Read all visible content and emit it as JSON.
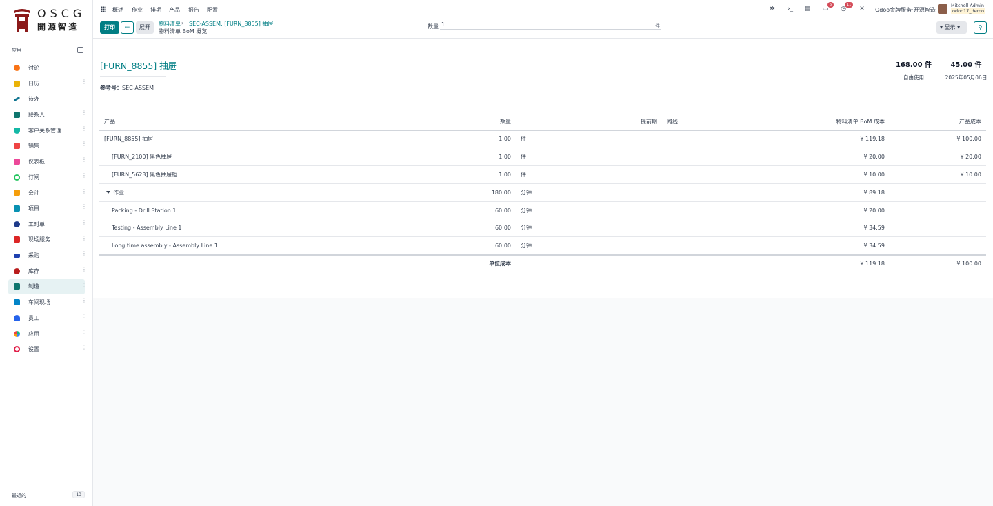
{
  "brand": {
    "name": "OSCG",
    "subtitle": "開源智造",
    "logo_color": "#8b1a1a"
  },
  "sidebar": {
    "apps_label": "应用",
    "items": [
      {
        "label": "讨论",
        "color": "#f97316"
      },
      {
        "label": "日历",
        "color": "#eab308"
      },
      {
        "label": "待办",
        "color": "#0e7490"
      },
      {
        "label": "联系人",
        "color": "#0f766e"
      },
      {
        "label": "客户关系管理",
        "color": "#14b8a6"
      },
      {
        "label": "销售",
        "color": "#ef4444"
      },
      {
        "label": "仪表板",
        "color": "#ec4899"
      },
      {
        "label": "订阅",
        "color": "#22c55e"
      },
      {
        "label": "会计",
        "color": "#f59e0b"
      },
      {
        "label": "项目",
        "color": "#0891b2"
      },
      {
        "label": "工时单",
        "color": "#1e3a8a"
      },
      {
        "label": "现场服务",
        "color": "#dc2626"
      },
      {
        "label": "采购",
        "color": "#1e40af"
      },
      {
        "label": "库存",
        "color": "#b91c1c"
      },
      {
        "label": "制造",
        "color": "#0f766e"
      },
      {
        "label": "车间现场",
        "color": "#0284c7"
      },
      {
        "label": "员工",
        "color": "#2563eb"
      },
      {
        "label": "应用",
        "color": "#10b981"
      },
      {
        "label": "设置",
        "color": "#e11d48"
      }
    ],
    "recent_label": "最近的",
    "recent_count": "13"
  },
  "topnav": {
    "items": [
      "概述",
      "作业",
      "排期",
      "产品",
      "报告",
      "配置"
    ],
    "badge_messages": "6",
    "badge_activities": "11",
    "company": "Odoo金牌服务·开源智造",
    "user_name": "Mitchell Admin",
    "user_db": "odoo17_demo"
  },
  "control": {
    "print_label": "打印",
    "back_icon": "arrow-left-icon",
    "expand_label": "展开",
    "breadcrumb_parent": "物料清单",
    "breadcrumb_current": "SEC-ASSEM: [FURN_8855] 抽屉",
    "subtitle": "物料清单 BoM 概览",
    "quantity_label": "数量",
    "quantity_value": "1",
    "quantity_uom": "件",
    "show_label": "显示"
  },
  "report": {
    "title": "[FURN_8855] 抽屉",
    "ref_label": "参考号：",
    "ref_value": "SEC-ASSEM",
    "kpi_free": {
      "value": "168.00 件",
      "label": "自由使用"
    },
    "kpi_forecast": {
      "value": "45.00 件",
      "label": "2025年05月06日"
    },
    "columns": [
      "产品",
      "数量",
      "",
      "提前期",
      "路线",
      "物料清单 BoM 成本",
      "产品成本"
    ],
    "rows": [
      {
        "product": "[FURN_8855] 抽屉",
        "qty": "1.00",
        "uom": "件",
        "bom_cost": "¥ 119.18",
        "prod_cost": "¥ 100.00"
      },
      {
        "product": "[FURN_2100] 黑色抽屉",
        "qty": "1.00",
        "uom": "件",
        "bom_cost": "¥ 20.00",
        "prod_cost": "¥ 20.00"
      },
      {
        "product": "[FURN_5623] 黑色抽屉柜",
        "qty": "1.00",
        "uom": "件",
        "bom_cost": "¥ 10.00",
        "prod_cost": "¥ 10.00"
      },
      {
        "product": "作业",
        "qty": "180:00",
        "uom": "分钟",
        "bom_cost": "¥ 89.18",
        "prod_cost": ""
      },
      {
        "product": "Packing - Drill Station 1",
        "qty": "60:00",
        "uom": "分钟",
        "bom_cost": "¥ 20.00",
        "prod_cost": ""
      },
      {
        "product": "Testing - Assembly Line 1",
        "qty": "60:00",
        "uom": "分钟",
        "bom_cost": "¥ 34.59",
        "prod_cost": ""
      },
      {
        "product": "Long time assembly - Assembly Line 1",
        "qty": "60:00",
        "uom": "分钟",
        "bom_cost": "¥ 34.59",
        "prod_cost": ""
      }
    ],
    "total": {
      "label": "单位成本",
      "bom_cost": "¥ 119.18",
      "prod_cost": "¥ 100.00"
    }
  }
}
